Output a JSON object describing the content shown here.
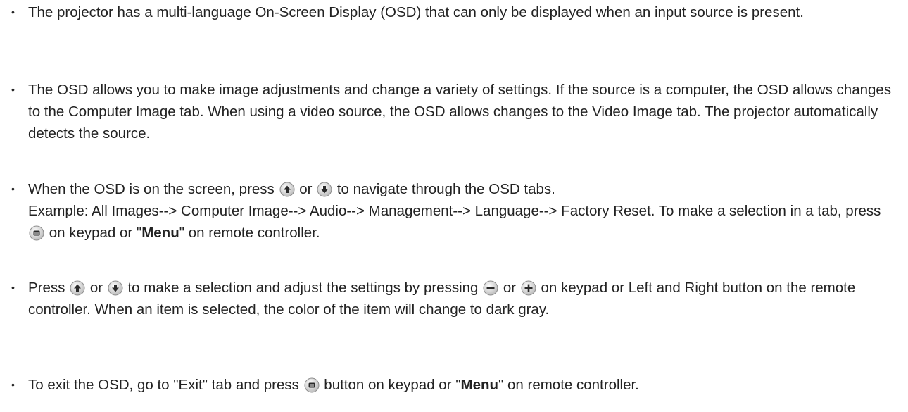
{
  "bullets": [
    {
      "text": "The projector has a multi-language On-Screen Display (OSD) that can only be displayed when an input source is present."
    },
    {
      "text": "The OSD allows you to make image adjustments and change a variety of settings. If the source is a computer, the OSD allows changes to the Computer Image tab. When using a video source, the OSD allows changes to the Video Image tab. The projector automatically detects the source."
    },
    {
      "p1": "When the OSD is on the screen, press",
      "p2": "or",
      "p3": "to navigate through the OSD tabs.",
      "p4": "Example: All Images--> Computer Image--> Audio--> Management--> Language--> Factory Reset. To make a selection in a tab, press",
      "p5": "on keypad or \"",
      "menu": "Menu",
      "p6": "\" on remote controller."
    },
    {
      "p1": "Press",
      "p2": "or",
      "p3": "to make a selection and adjust the settings by pressing",
      "p4": "or",
      "p5": "on keypad or Left and Right button on the remote controller. When an item is selected, the color of the item will change to dark gray."
    },
    {
      "p1": "To exit the OSD, go to \"Exit\" tab and press",
      "p2": "button on keypad or \"",
      "menu": "Menu",
      "p3": "\" on remote controller."
    }
  ],
  "bullet_symbol": "•",
  "icons": {
    "up": "up-arrow-button-icon",
    "down": "down-arrow-button-icon",
    "menu": "menu-button-icon",
    "minus": "minus-button-icon",
    "plus": "plus-button-icon"
  }
}
